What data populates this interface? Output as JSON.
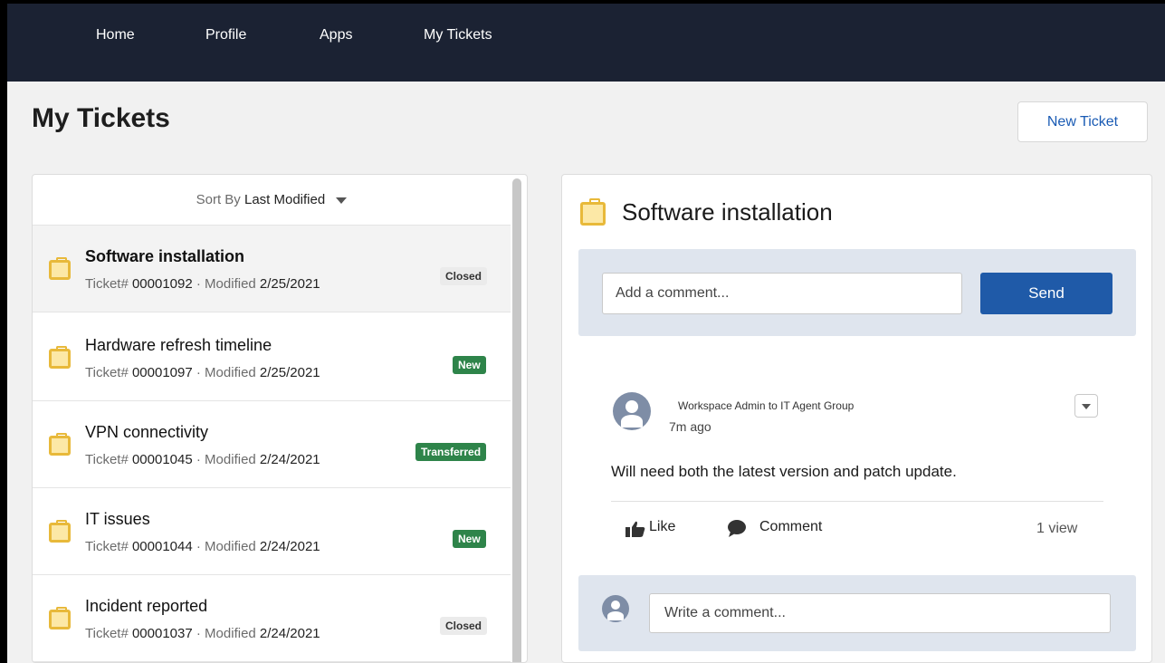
{
  "nav": {
    "items": [
      {
        "label": "Home"
      },
      {
        "label": "Profile"
      },
      {
        "label": "Apps"
      },
      {
        "label": "My Tickets"
      }
    ]
  },
  "page": {
    "title": "My Tickets",
    "new_ticket_label": "New Ticket"
  },
  "list": {
    "sort_prefix": "Sort By",
    "sort_value": "Last Modified",
    "ticket_prefix": "Ticket#",
    "modified_prefix": "· Modified",
    "tickets": [
      {
        "title": "Software installation",
        "number": "00001092",
        "modified": "2/25/2021",
        "status": "Closed",
        "selected": true
      },
      {
        "title": "Hardware refresh timeline",
        "number": "00001097",
        "modified": "2/25/2021",
        "status": "New",
        "selected": false
      },
      {
        "title": "VPN connectivity",
        "number": "00001045",
        "modified": "2/24/2021",
        "status": "Transferred",
        "selected": false
      },
      {
        "title": " IT issues",
        "number": "00001044",
        "modified": "2/24/2021",
        "status": "New",
        "selected": false
      },
      {
        "title": "Incident reported",
        "number": "00001037",
        "modified": "2/24/2021",
        "status": "Closed",
        "selected": false
      }
    ]
  },
  "detail": {
    "title": "Software installation",
    "comment_placeholder": "Add a comment...",
    "send_label": "Send",
    "post": {
      "author_line": "Workspace Admin to IT Agent Group",
      "time": "7m ago",
      "body": "Will need both the latest version and patch update.",
      "like_label": "Like",
      "comment_label": "Comment",
      "views": "1 view"
    },
    "reply_placeholder": "Write a comment..."
  },
  "colors": {
    "nav_bg": "#1b2233",
    "accent": "#1f5aa8",
    "badge_green": "#2e844a",
    "badge_grey": "#ebebeb",
    "ticket_icon": "#e8b93a"
  },
  "icons": {
    "ticket": "ticket-case-icon",
    "sort": "caret-down-icon",
    "avatar": "user-avatar-icon",
    "like": "thumbs-up-icon",
    "comment": "speech-bubble-icon",
    "menu": "chevron-down-icon"
  }
}
